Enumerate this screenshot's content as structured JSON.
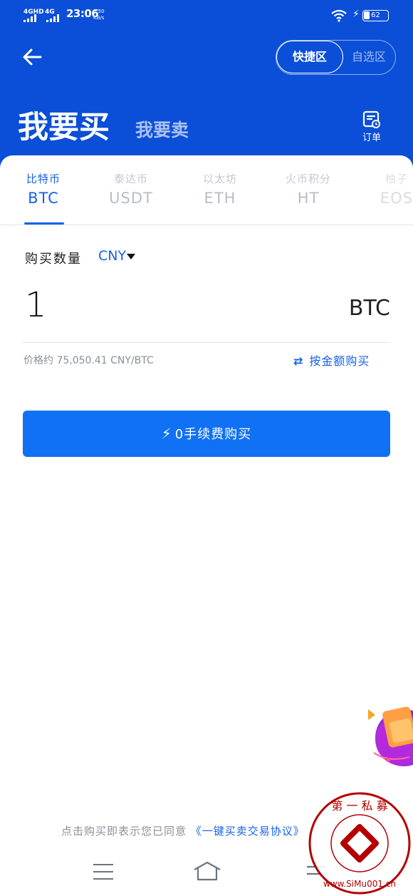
{
  "status_bar": {
    "network_1": "4GHD",
    "network_2": "4G",
    "time": "23:06",
    "speed_value": "0.50",
    "speed_unit": "KB/s",
    "battery": "62"
  },
  "header": {
    "zone_active": "快捷区",
    "zone_inactive": "自选区",
    "title_buy": "我要买",
    "title_sell": "我要卖",
    "orders_label": "订单"
  },
  "tabs": [
    {
      "name_cn": "比特币",
      "code": "BTC"
    },
    {
      "name_cn": "泰达币",
      "code": "USDT"
    },
    {
      "name_cn": "以太坊",
      "code": "ETH"
    },
    {
      "name_cn": "火币积分",
      "code": "HT"
    },
    {
      "name_cn": "柚子",
      "code": "EOS"
    }
  ],
  "form": {
    "quantity_label": "购买数量",
    "currency": "CNY",
    "amount": "1",
    "unit": "BTC",
    "price_text": "价格约 75,050.41 CNY/BTC",
    "buy_by_amount": "按金额购买"
  },
  "buy_button": "0手续费购买",
  "agreement": {
    "text": "点击购买即表示您已同意",
    "link": "《一键买卖交易协议》"
  },
  "watermark": {
    "top_text": "第 一 私 募",
    "bottom_text": "www.SiMu001.cn"
  },
  "colors": {
    "header_bg": "#0b4fd8",
    "accent": "#1662e8",
    "button": "#1071f4"
  }
}
